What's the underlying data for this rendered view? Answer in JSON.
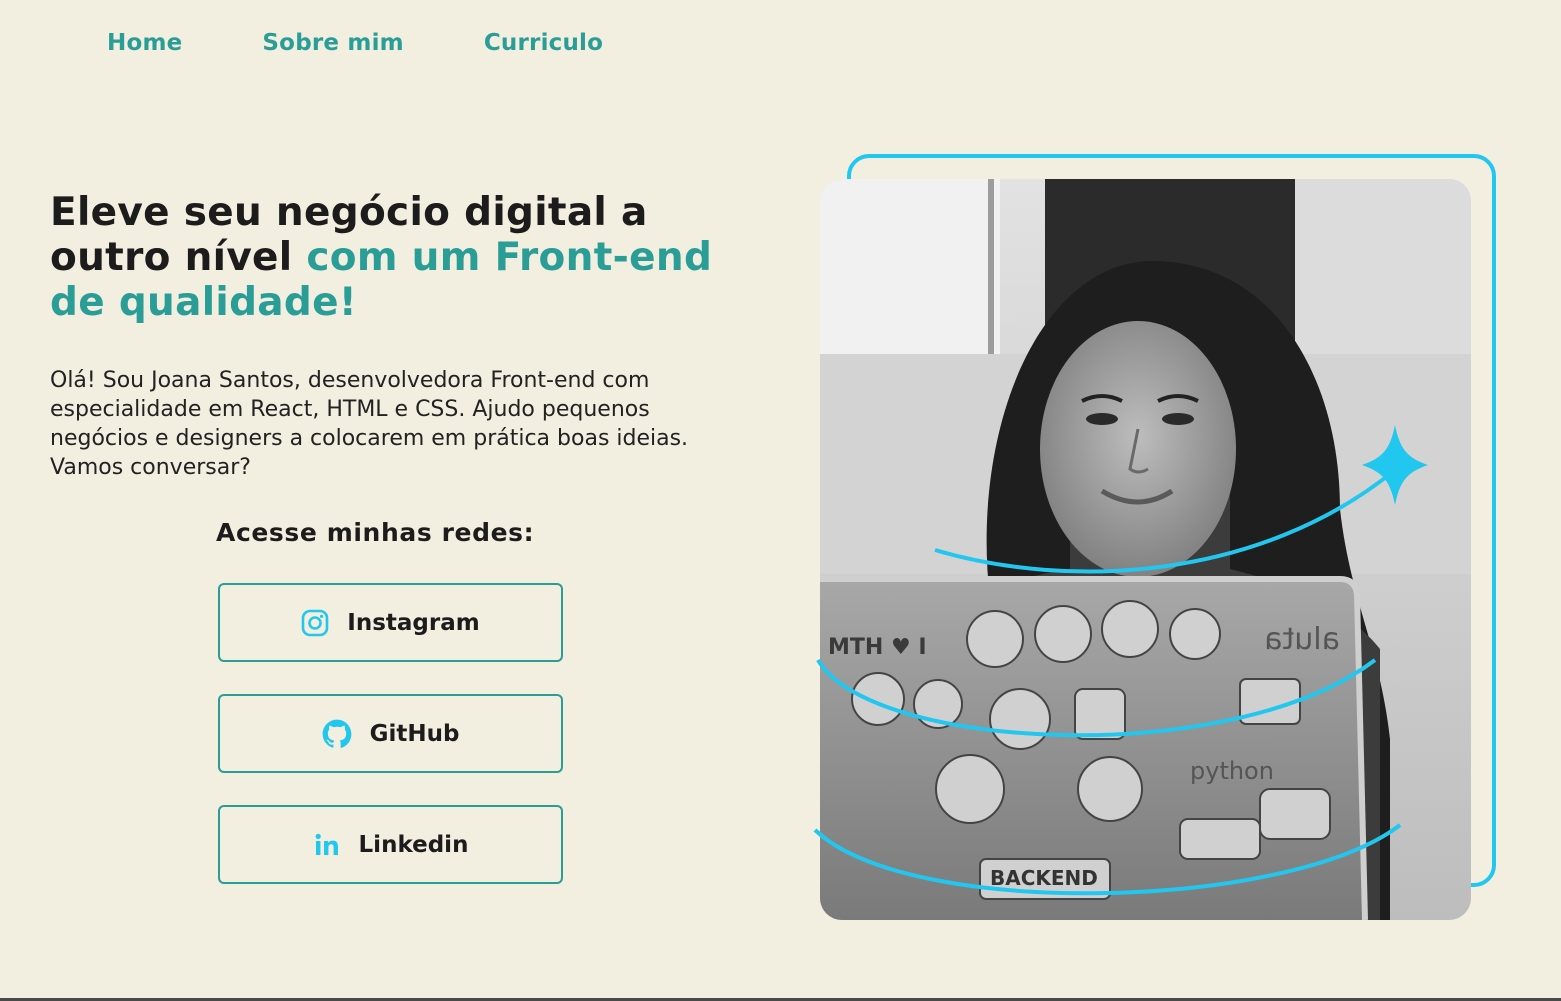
{
  "nav": {
    "items": [
      {
        "label": "Home"
      },
      {
        "label": "Sobre mim"
      },
      {
        "label": "Curriculo"
      }
    ]
  },
  "hero": {
    "title_part1": "Eleve seu negócio digital a outro nível ",
    "title_accent": "com um Front-end de qualidade!",
    "description": "Olá! Sou Joana Santos, desenvolvedora Front-end com especialidade em React, HTML e CSS. Ajudo pequenos negócios e designers a colocarem em prática boas ideias. Vamos conversar?"
  },
  "social": {
    "title": "Acesse minhas redes:",
    "buttons": [
      {
        "label": "Instagram",
        "icon": "instagram-icon"
      },
      {
        "label": "GitHub",
        "icon": "github-icon"
      },
      {
        "label": "Linkedin",
        "icon": "linkedin-icon"
      }
    ]
  },
  "photo": {
    "sticker_text_1": "MTH ♥ I",
    "sticker_text_2": "aluta",
    "sticker_text_3": "python",
    "sticker_text_4": "BACKEND"
  },
  "colors": {
    "background": "#f2eee0",
    "accent": "#2a9d97",
    "highlight": "#22c7ef",
    "text": "#1c1c1c"
  }
}
